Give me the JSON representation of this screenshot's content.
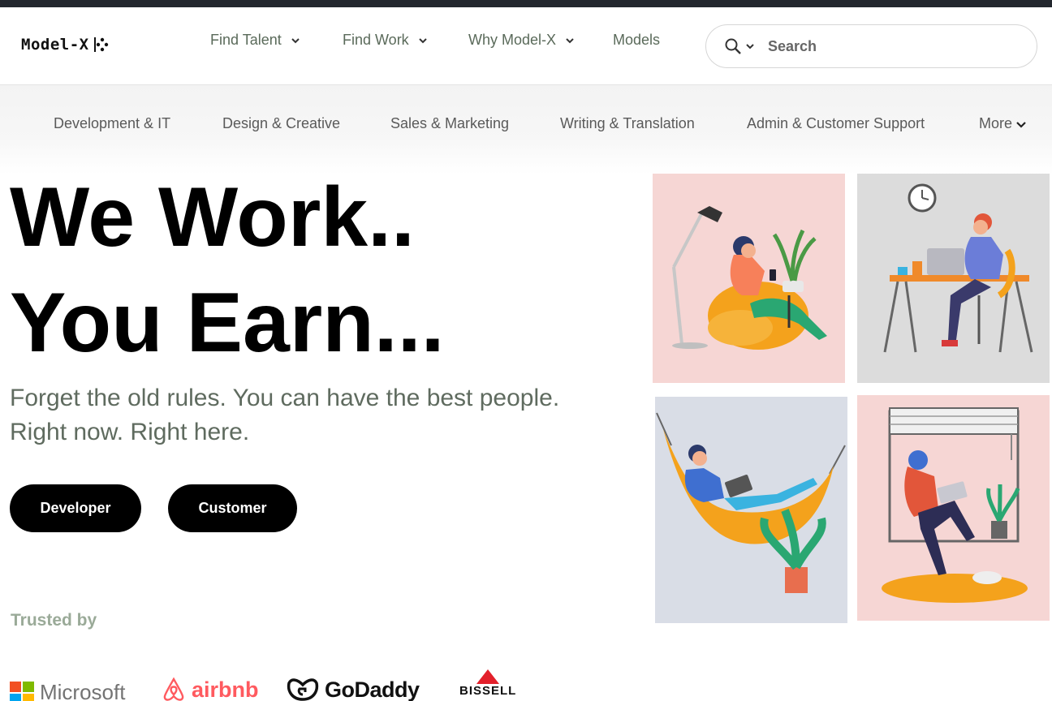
{
  "header": {
    "logo_text": "Model-X",
    "nav": [
      {
        "label": "Find Talent",
        "has_dropdown": true
      },
      {
        "label": "Find Work",
        "has_dropdown": true
      },
      {
        "label": "Why Model-X",
        "has_dropdown": true
      },
      {
        "label": "Models",
        "has_dropdown": false
      }
    ],
    "search": {
      "placeholder": "Search"
    }
  },
  "categories": [
    {
      "label": "Development & IT"
    },
    {
      "label": "Design & Creative"
    },
    {
      "label": "Sales & Marketing"
    },
    {
      "label": "Writing & Translation"
    },
    {
      "label": "Admin & Customer Support"
    },
    {
      "label": "More"
    }
  ],
  "hero": {
    "line1": "We Work..",
    "line2": "You Earn...",
    "sub1": "Forget the old rules. You can have the best people.",
    "sub2": "Right now. Right here.",
    "buttons": [
      {
        "label": "Developer"
      },
      {
        "label": "Customer"
      }
    ]
  },
  "trusted": {
    "label": "Trusted by",
    "brands": [
      "Microsoft",
      "airbnb",
      "GoDaddy",
      "BISSELL"
    ]
  },
  "colors": {
    "topbar": "#23272e",
    "button_bg": "#000000",
    "nav_text": "#5a6a5a",
    "trusted_text": "#9aaa98",
    "pink_panel": "#f6d6d4",
    "grey_panel": "#dcdcdc",
    "blue_panel": "#d9dde6",
    "orange": "#f4a21c"
  }
}
